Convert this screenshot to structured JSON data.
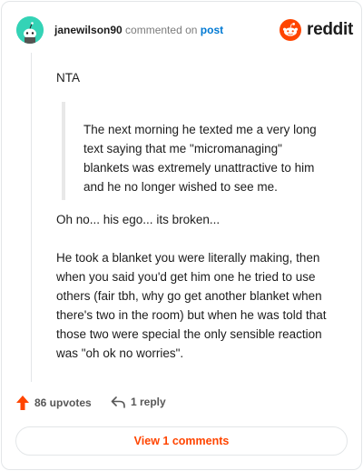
{
  "header": {
    "username": "janewilson90",
    "action_text": "commented on",
    "post_link": "post",
    "brand_name": "reddit",
    "brand_color": "#ff4500",
    "avatar_color": "#34d3b6"
  },
  "comment": {
    "first_line": "NTA",
    "quote": "The next morning he texted me a very long text saying that me \"micromanaging\" blankets was extremely unattractive to him and he no longer wished to see me.",
    "paragraph_1": "Oh no... his ego... its broken...",
    "paragraph_2": "He took a blanket you were literally making, then when you said you'd get him one he tried to use others (fair tbh, why go get another blanket when there's two in the room) but when he was told that those two were special the only sensible reaction was \"oh ok no worries\"."
  },
  "actions": {
    "upvotes_label": "86 upvotes",
    "reply_label": "1 reply",
    "upvote_icon": "upvote-arrow-icon",
    "reply_icon": "reply-arrow-icon"
  },
  "footer": {
    "view_button_label": "View 1 comments"
  }
}
